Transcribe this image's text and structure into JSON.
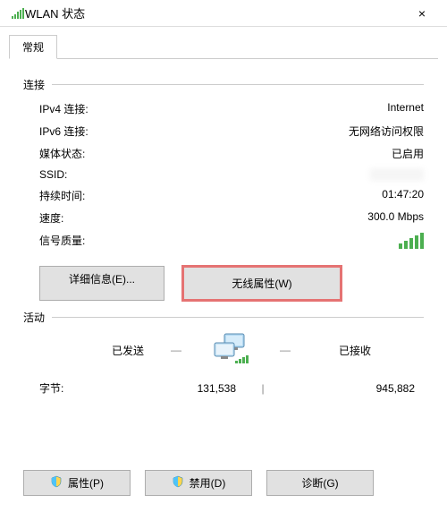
{
  "window": {
    "title": "WLAN 状态",
    "close_label": "×"
  },
  "tabs": {
    "general": "常规"
  },
  "connection": {
    "header": "连接",
    "ipv4_label": "IPv4 连接:",
    "ipv4_value": "Internet",
    "ipv6_label": "IPv6 连接:",
    "ipv6_value": "无网络访问权限",
    "media_label": "媒体状态:",
    "media_value": "已启用",
    "ssid_label": "SSID:",
    "ssid_value": "             ",
    "duration_label": "持续时间:",
    "duration_value": "01:47:20",
    "speed_label": "速度:",
    "speed_value": "300.0 Mbps",
    "signal_label": "信号质量:"
  },
  "buttons": {
    "details": "详细信息(E)...",
    "wireless_properties": "无线属性(W)"
  },
  "activity": {
    "header": "活动",
    "sent_label": "已发送",
    "received_label": "已接收",
    "bytes_label": "字节:",
    "bytes_sent": "131,538",
    "bytes_received": "945,882"
  },
  "bottom": {
    "properties": "属性(P)",
    "disable": "禁用(D)",
    "diagnose": "诊断(G)"
  }
}
